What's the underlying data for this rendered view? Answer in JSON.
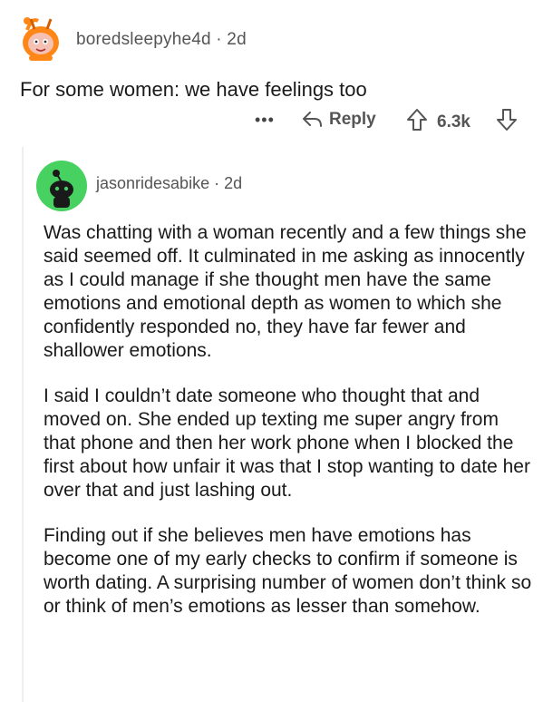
{
  "parent_comment": {
    "username": "boredsleepyhe4d",
    "separator": "·",
    "age": "2d",
    "text": "For some women: we have feelings too",
    "more_label": "•••",
    "reply_label": "Reply",
    "score": "6.3k"
  },
  "reply_comment": {
    "username": "jasonridesabike",
    "separator": "·",
    "age": "2d",
    "paragraphs": [
      "Was chatting with a woman recently and a few things she said seemed off. It culminated in me asking as innocently as I could manage if she thought men have the same emotions and emotional depth as women to which she confidently responded no, they have far fewer and shallower emotions.",
      "I said I couldn’t date someone who thought that and moved on. She ended up texting me super angry from that phone and then her work phone when I blocked the first about how unfair it was that I stop wanting to date her over that and just lashing out.",
      "Finding out if she believes men have emotions has become one of my early checks to confirm if someone is worth dating. A surprising number of women don’t think so or think of men’s emotions as lesser than somehow."
    ]
  },
  "colors": {
    "avatar_green": "#46d160",
    "avatar_orange": "#ff8717",
    "meta_gray": "#555555"
  }
}
